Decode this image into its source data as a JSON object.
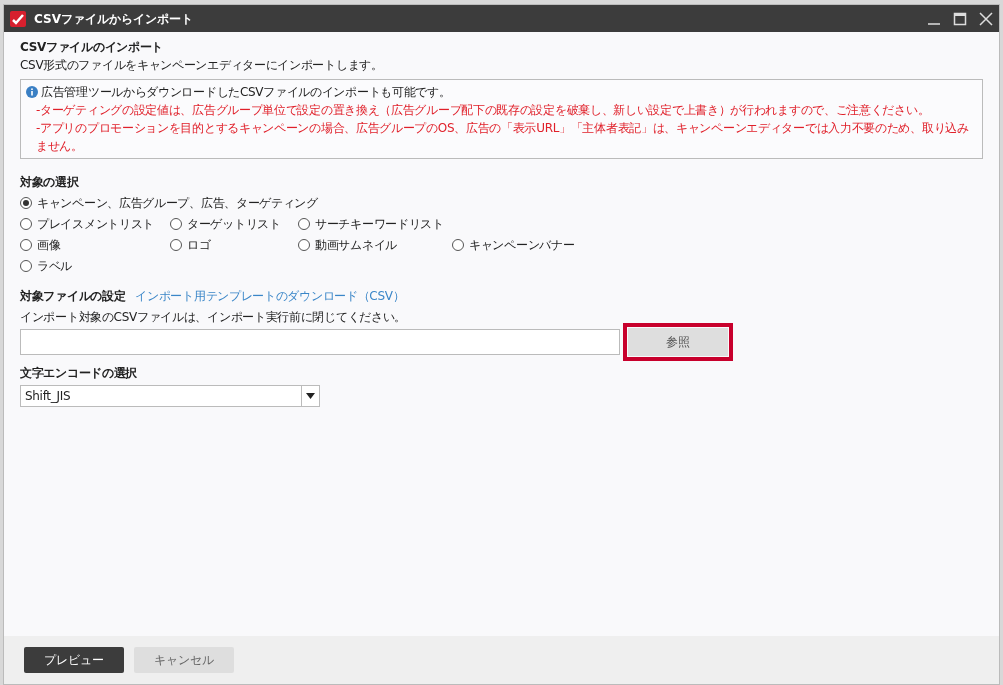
{
  "window": {
    "title": "CSVファイルからインポート"
  },
  "header": {
    "title": "CSVファイルのインポート",
    "description": "CSV形式のファイルをキャンペーンエディターにインポートします。"
  },
  "notice": {
    "info": "広告管理ツールからダウンロードしたCSVファイルのインポートも可能です。",
    "warnings": [
      "-ターゲティングの設定値は、広告グループ単位で設定の置き換え（広告グループ配下の既存の設定を破棄し、新しい設定で上書き）が行われますので、ご注意ください。",
      "-アプリのプロモーションを目的とするキャンペーンの場合、広告グループのOS、広告の「表示URL」「主体者表記」は、キャンペーンエディターでは入力不要のため、取り込みません。"
    ]
  },
  "target_selection": {
    "label": "対象の選択",
    "rows": [
      [
        {
          "label": "キャンペーン、広告グループ、広告、ターゲティング",
          "selected": true
        }
      ],
      [
        {
          "label": "プレイスメントリスト",
          "selected": false
        },
        {
          "label": "ターゲットリスト",
          "selected": false
        },
        {
          "label": "サーチキーワードリスト",
          "selected": false
        }
      ],
      [
        {
          "label": "画像",
          "selected": false
        },
        {
          "label": "ロゴ",
          "selected": false
        },
        {
          "label": "動画サムネイル",
          "selected": false
        },
        {
          "label": "キャンペーンバナー",
          "selected": false
        }
      ],
      [
        {
          "label": "ラベル",
          "selected": false
        }
      ]
    ]
  },
  "file_settings": {
    "label": "対象ファイルの設定",
    "template_link": "インポート用テンプレートのダウンロード（CSV）",
    "hint": "インポート対象のCSVファイルは、インポート実行前に閉じてください。",
    "browse_button": {
      "label": "参照",
      "highlighted": true
    }
  },
  "encoding": {
    "label": "文字エンコードの選択",
    "value": "Shift_JIS"
  },
  "footer": {
    "buttons": [
      {
        "label": "プレビュー",
        "kind": "primary"
      },
      {
        "label": "キャンセル",
        "kind": "secondary"
      }
    ]
  }
}
